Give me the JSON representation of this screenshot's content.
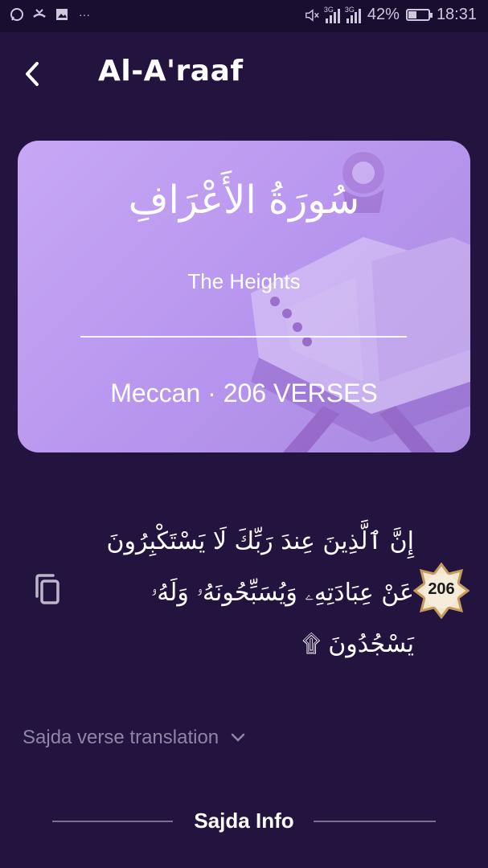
{
  "status_bar": {
    "battery_percent": "42%",
    "battery_level": 0.42,
    "time": "18:31",
    "network_label_1": "3G",
    "network_label_2": "3G",
    "icons": [
      "whatsapp-icon",
      "missed-call-icon",
      "image-icon",
      "more-dots-icon",
      "mute-icon"
    ]
  },
  "header": {
    "title": "Al-A'raaf"
  },
  "surah_card": {
    "arabic_name": "سُورَةُ الأَعْرَافِ",
    "translation": "The Heights",
    "meta": "Meccan  · 206 VERSES"
  },
  "verse": {
    "number": "206",
    "arabic_line_1": "إِنَّ ٱلَّذِينَ عِندَ رَبِّكَ لَا يَسْتَكْبِرُونَ",
    "arabic_line_2": "عَنْ عِبَادَتِهِۦ وَيُسَبِّحُونَهُۥ وَلَهُۥ",
    "arabic_line_3": "يَسْجُدُونَ ۩"
  },
  "sajda": {
    "translation_toggle": "Sajda verse translation",
    "info_title": "Sajda Info"
  },
  "colors": {
    "background": "#23133f",
    "card": "#c4a4f4",
    "accent_text": "#8f86a6"
  }
}
